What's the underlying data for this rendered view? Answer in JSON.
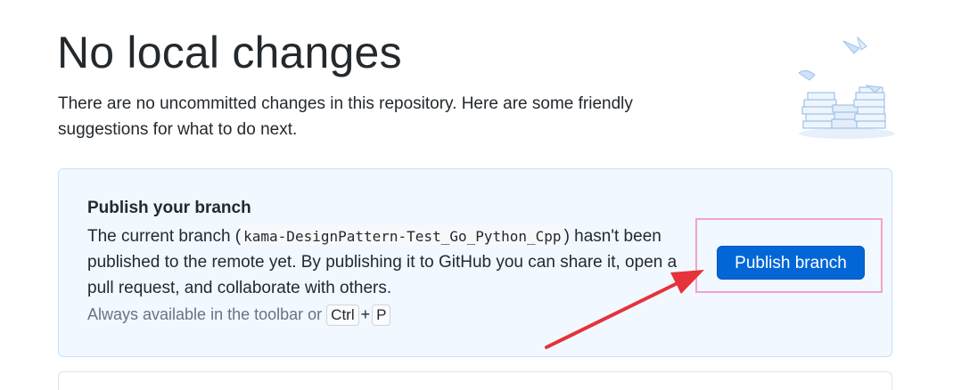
{
  "header": {
    "title": "No local changes",
    "subtitle": "There are no uncommitted changes in this repository. Here are some friendly suggestions for what to do next."
  },
  "publish_card": {
    "title": "Publish your branch",
    "desc_before": "The current branch (",
    "branch_name": "kama-DesignPattern-Test_Go_Python_Cpp",
    "desc_after": ") hasn't been published to the remote yet. By publishing it to GitHub you can share it, open a pull request, and collaborate with others.",
    "hint_prefix": "Always available in the toolbar or",
    "shortcut_key_1": "Ctrl",
    "shortcut_plus": "+",
    "shortcut_key_2": "P",
    "button_label": "Publish branch"
  },
  "icons": {
    "illustration": "paper-stacks-illustration",
    "annotation_arrow": "red-arrow-annotation",
    "annotation_box": "pink-highlight-box"
  },
  "colors": {
    "accent": "#0366d6",
    "card_bg": "#f1f8ff",
    "annotation_red": "#e5323b",
    "annotation_pink": "#f4a4c8"
  }
}
